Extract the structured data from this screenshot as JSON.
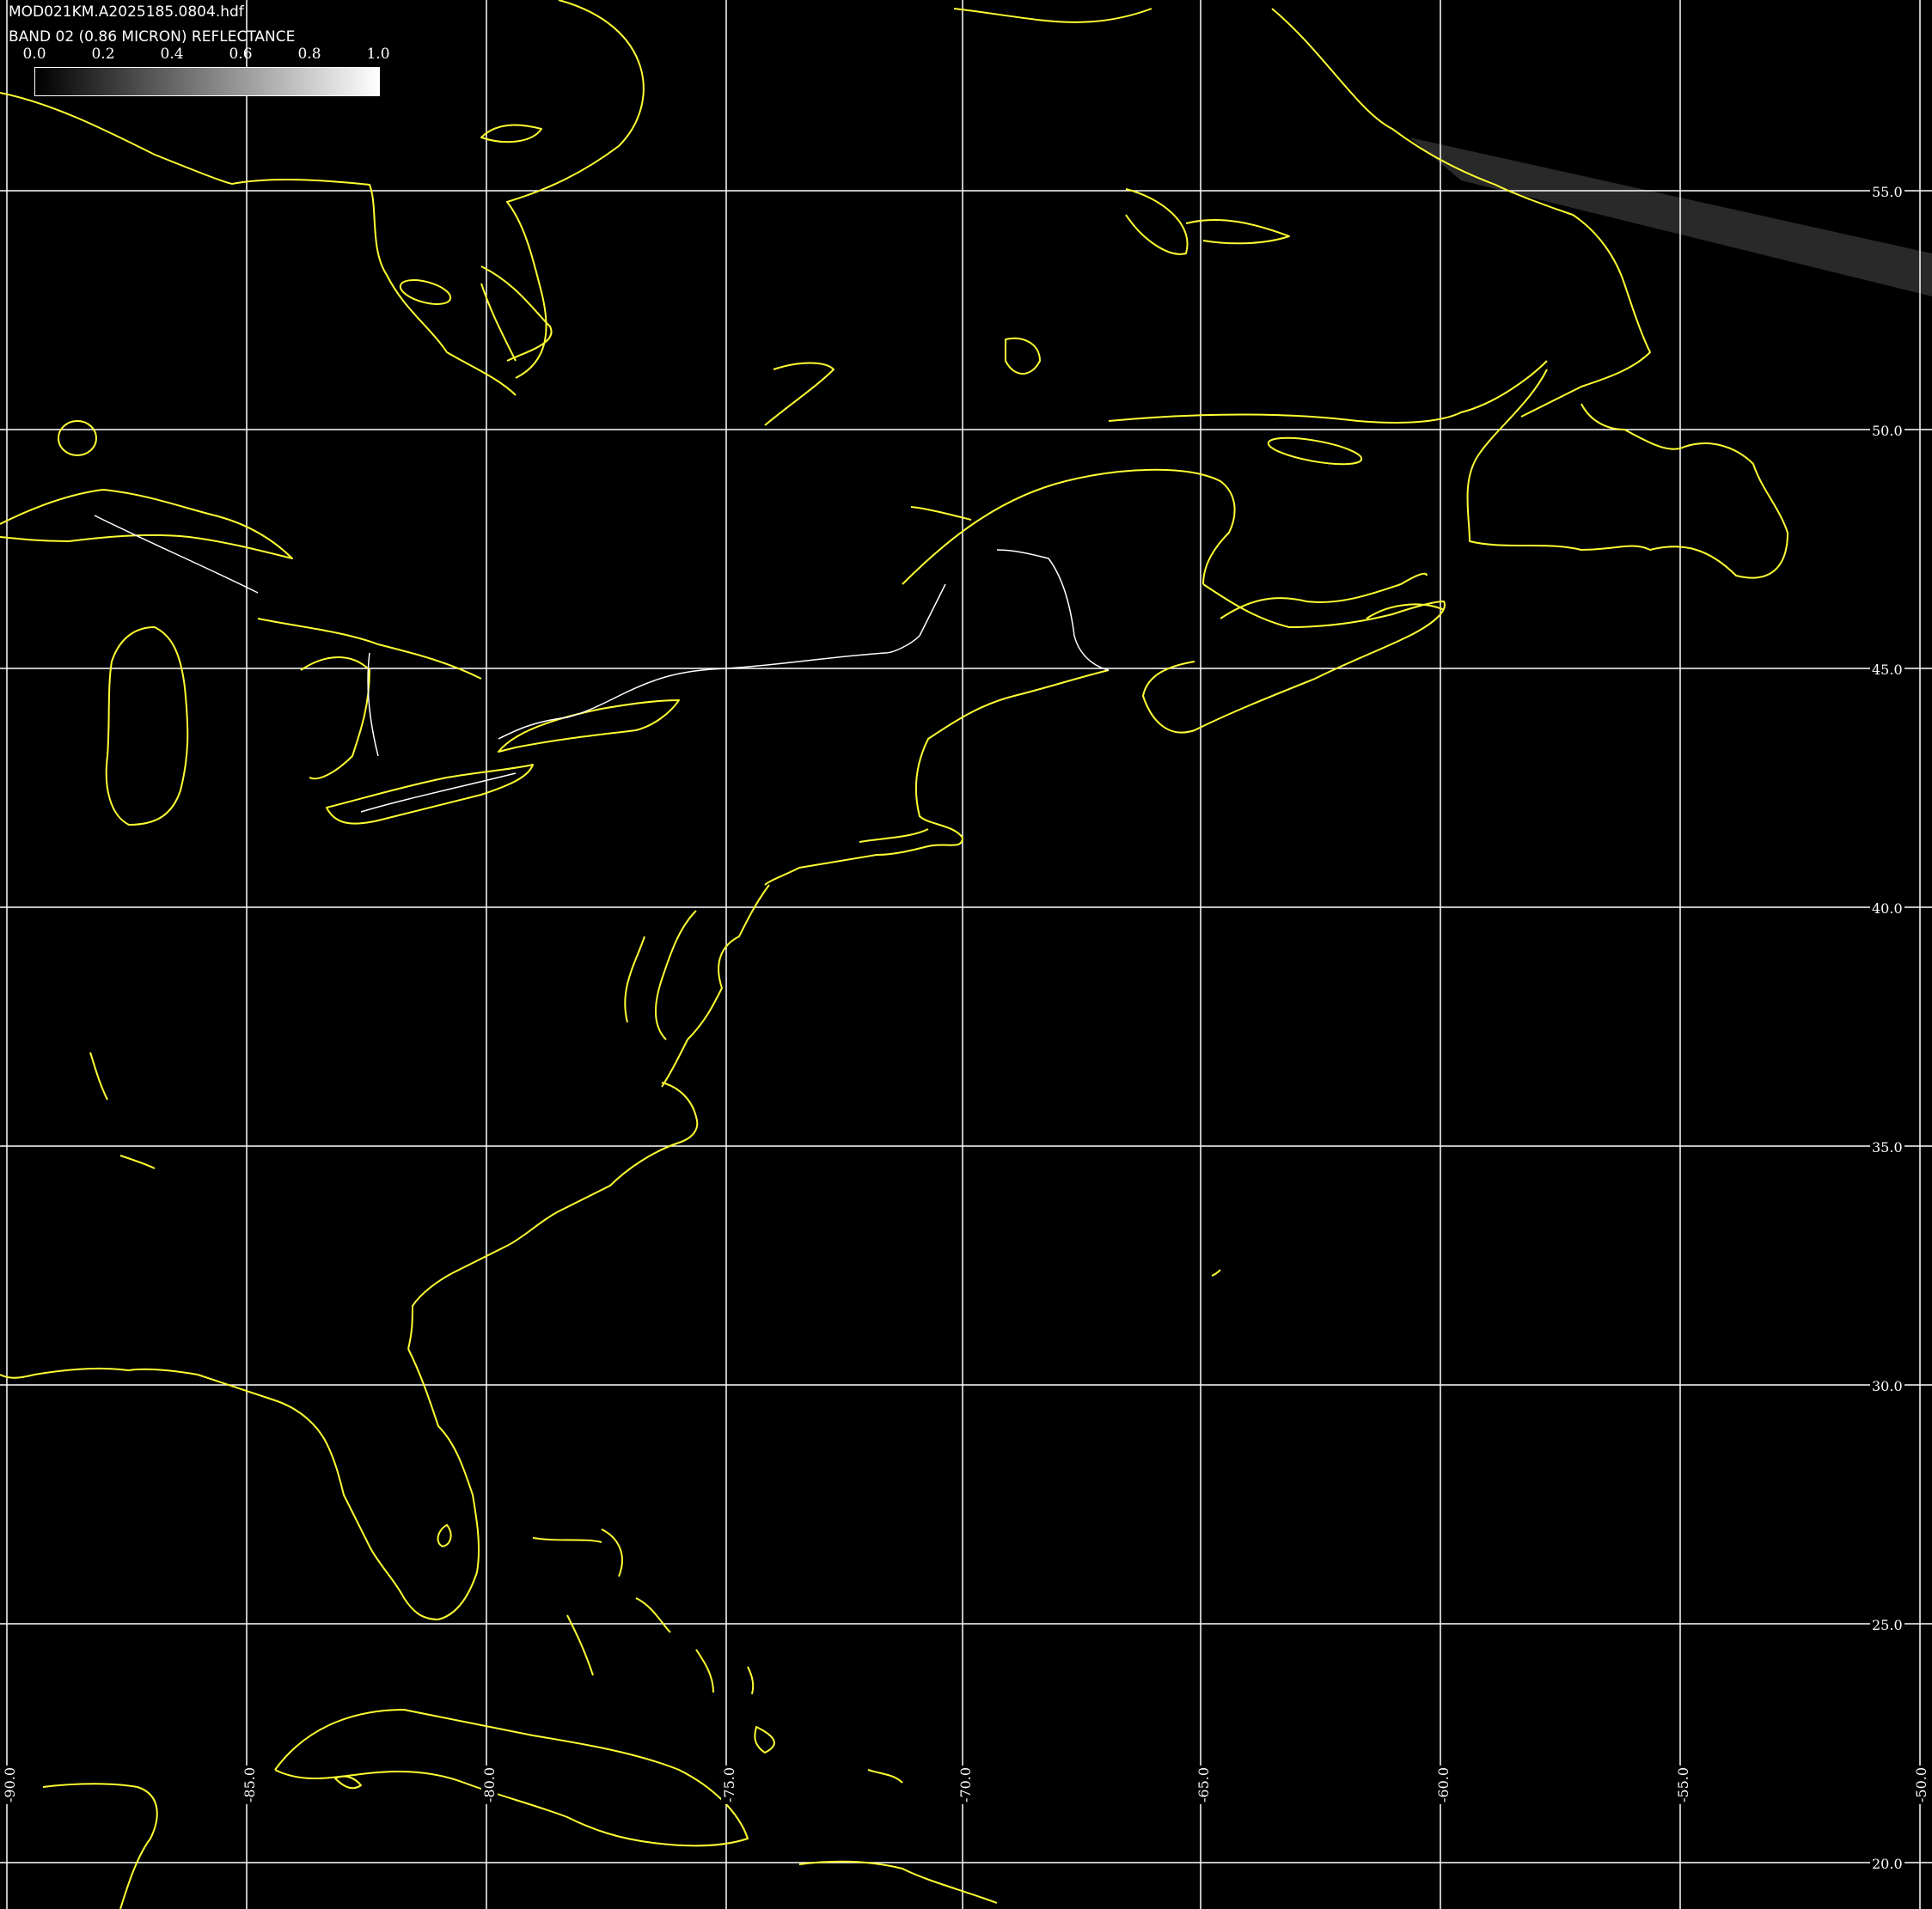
{
  "header": {
    "filename": "MOD021KM.A2025185.0804.hdf",
    "band_label": "BAND 02 (0.86 MICRON) REFLECTANCE"
  },
  "colorbar": {
    "ticks": [
      "0.0",
      "0.2",
      "0.4",
      "0.6",
      "0.8",
      "1.0"
    ],
    "min_color": "#000000",
    "max_color": "#ffffff"
  },
  "grid": {
    "line_color": "#ffffff",
    "lat_labels": [
      "55.0",
      "50.0",
      "45.0",
      "40.0",
      "35.0",
      "30.0",
      "25.0",
      "20.0"
    ],
    "lon_labels": [
      "-90.0",
      "-85.0",
      "-80.0",
      "-75.0",
      "-70.0",
      "-65.0",
      "-60.0",
      "-55.0",
      "-50.0"
    ]
  },
  "coastline_color": "#ffff33",
  "border_color": "#ffffff"
}
